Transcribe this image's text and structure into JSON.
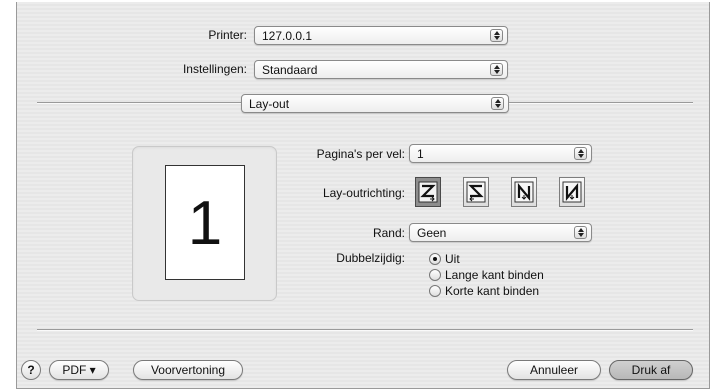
{
  "printer": {
    "label": "Printer:",
    "value": "127.0.0.1"
  },
  "presets": {
    "label": "Instellingen:",
    "value": "Standaard"
  },
  "panel": {
    "value": "Lay-out"
  },
  "layout": {
    "pages_label": "Pagina's per vel:",
    "pages_value": "1",
    "direction_label": "Lay-outrichting:",
    "border_label": "Rand:",
    "border_value": "Geen",
    "duplex_label": "Dubbelzijdig:",
    "duplex_options": [
      "Uit",
      "Lange kant binden",
      "Korte kant binden"
    ],
    "preview_number": "1"
  },
  "footer": {
    "help": "?",
    "pdf": "PDF ▾",
    "preview": "Voorvertoning",
    "cancel": "Annuleer",
    "print": "Druk af"
  }
}
